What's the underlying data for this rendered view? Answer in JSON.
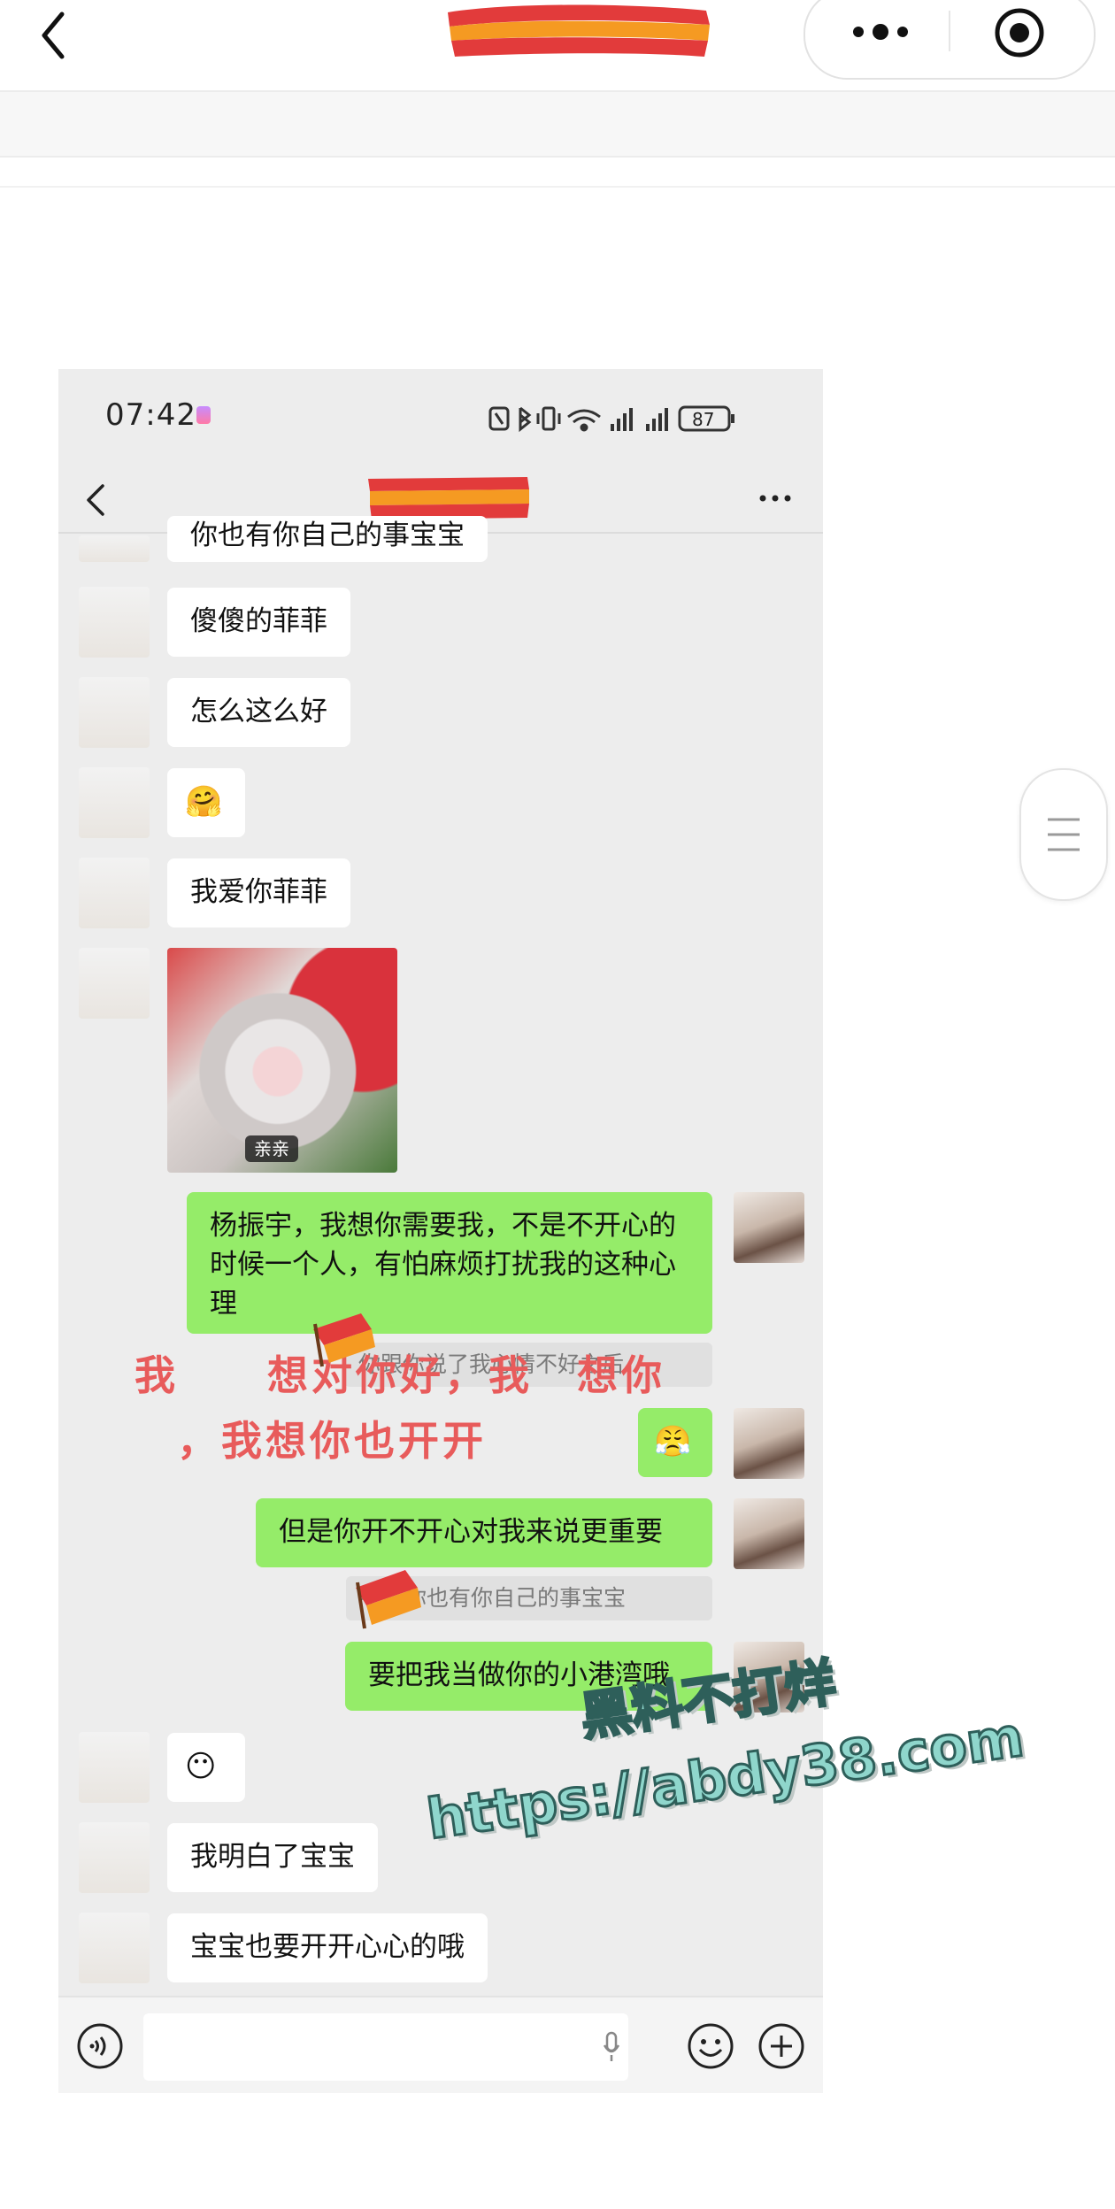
{
  "status": {
    "time": "07:42",
    "battery": "87"
  },
  "messages": {
    "top_partial": "你也有你自己的事宝宝",
    "m1": "傻傻的菲菲",
    "m2": "怎么这么好",
    "m3_emoji": "🤗",
    "m4": "我爱你菲菲",
    "photo_caption": "亲亲",
    "out1": "杨振宇，我想你需要我，不是不开心的时候一个人，有怕麻烦打扰我的这种心理",
    "quote1": "你跟你说了我心情不好之后",
    "out2_emoji": "😤",
    "out3": "但是你开不开心对我来说更重要",
    "quote2": "宇：你也有你自己的事宝宝",
    "out4": "要把我当做你的小港湾哦",
    "m5_emoji": "😶",
    "m6": "我明白了宝宝",
    "m7": "宝宝也要开开心心的哦"
  },
  "overlay": {
    "line1": "我　　想对你好，我　想你",
    "line2": "，我想你也开开"
  },
  "watermark": {
    "line1": "黑料不打烊",
    "line2": "https://abdy38.com"
  },
  "colors": {
    "out_bubble": "#95ec69",
    "in_bubble": "#ffffff",
    "chat_bg": "#ededed",
    "overlay_red": "#e85b5b"
  }
}
